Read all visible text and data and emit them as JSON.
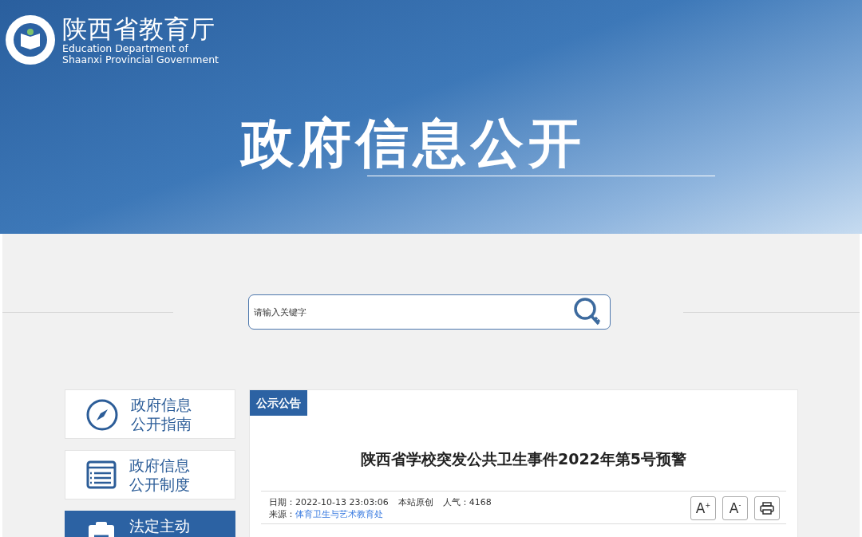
{
  "header": {
    "site_title": "陕西省教育厅",
    "site_subtitle_lines": [
      "Education Department of",
      "Shaanxi Provincial Government"
    ],
    "page_title": "政府信息公开"
  },
  "search": {
    "placeholder": "请输入关键字"
  },
  "sidebar": {
    "items": [
      {
        "kind": "compass",
        "lines": [
          "政府信息",
          "公开指南"
        ],
        "selected": false
      },
      {
        "kind": "list",
        "lines": [
          "政府信息",
          "公开制度"
        ],
        "selected": false
      },
      {
        "kind": "clipboard",
        "lines": [
          "法定主动"
        ],
        "selected": true
      }
    ]
  },
  "article": {
    "section_tab": "公示公告",
    "title": "陕西省学校突发公共卫生事件2022年第5号预警",
    "meta": {
      "date_label": "日期：",
      "date": "2022-10-13 23:03:06",
      "origin": "本站原创",
      "views_label": "人气：",
      "views": "4168",
      "source_label": "来源：",
      "source": "体育卫生与艺术教育处"
    },
    "tools": [
      {
        "kind": "text",
        "label": "A$^{+}$"
      },
      {
        "kind": "text",
        "label": "A$^{-}$"
      },
      {
        "kind": "print"
      }
    ]
  }
}
